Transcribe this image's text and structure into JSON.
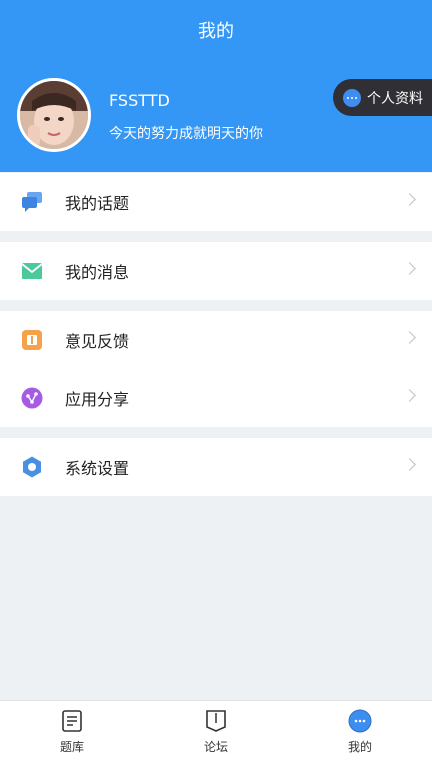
{
  "header": {
    "title": "我的"
  },
  "profile": {
    "username": "FSSTTD",
    "motto": "今天的努力成就明天的你",
    "profile_button": "个人资料"
  },
  "menu": {
    "topics": "我的话题",
    "messages": "我的消息",
    "feedback": "意见反馈",
    "share": "应用分享",
    "settings": "系统设置"
  },
  "tabs": {
    "questions": "题库",
    "forum": "论坛",
    "mine": "我的"
  },
  "colors": {
    "header": "#3497f5",
    "topics_icon": "#4a8ee8",
    "messages_icon": "#4cc99b",
    "feedback_icon": "#f5a24a",
    "share_icon": "#a55be6",
    "settings_icon": "#4a90e2",
    "active_tab": "#3d8ef0"
  }
}
